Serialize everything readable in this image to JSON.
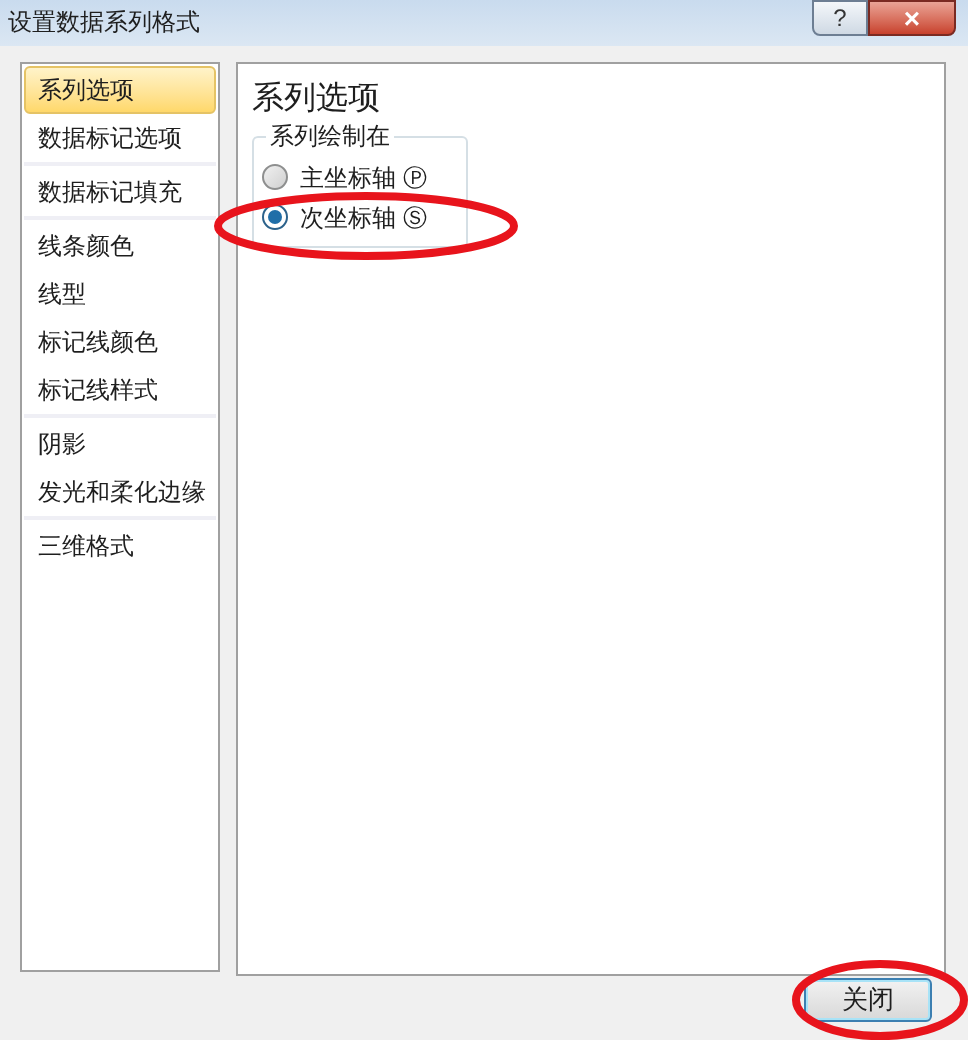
{
  "window": {
    "title": "设置数据系列格式",
    "buttons": [
      "?",
      "×"
    ]
  },
  "sidebar": {
    "groups": [
      {
        "items": [
          {
            "label": "系列选项",
            "selected": true
          },
          {
            "label": "数据标记选项",
            "selected": false
          }
        ]
      },
      {
        "items": [
          {
            "label": "数据标记填充",
            "selected": false
          }
        ]
      },
      {
        "items": [
          {
            "label": "线条颜色",
            "selected": false
          },
          {
            "label": "线型",
            "selected": false
          },
          {
            "label": "标记线颜色",
            "selected": false
          },
          {
            "label": "标记线样式",
            "selected": false
          }
        ]
      },
      {
        "items": [
          {
            "label": "阴影",
            "selected": false
          },
          {
            "label": "发光和柔化边缘",
            "selected": false
          }
        ]
      },
      {
        "items": [
          {
            "label": "三维格式",
            "selected": false
          }
        ]
      }
    ]
  },
  "panel": {
    "title": "系列选项",
    "group_title": "系列绘制在",
    "options": [
      {
        "label": "主坐标轴",
        "key": "Ⓟ",
        "selected": false
      },
      {
        "label": "次坐标轴",
        "key": "Ⓢ",
        "selected": true
      }
    ]
  },
  "close_button": "关闭"
}
